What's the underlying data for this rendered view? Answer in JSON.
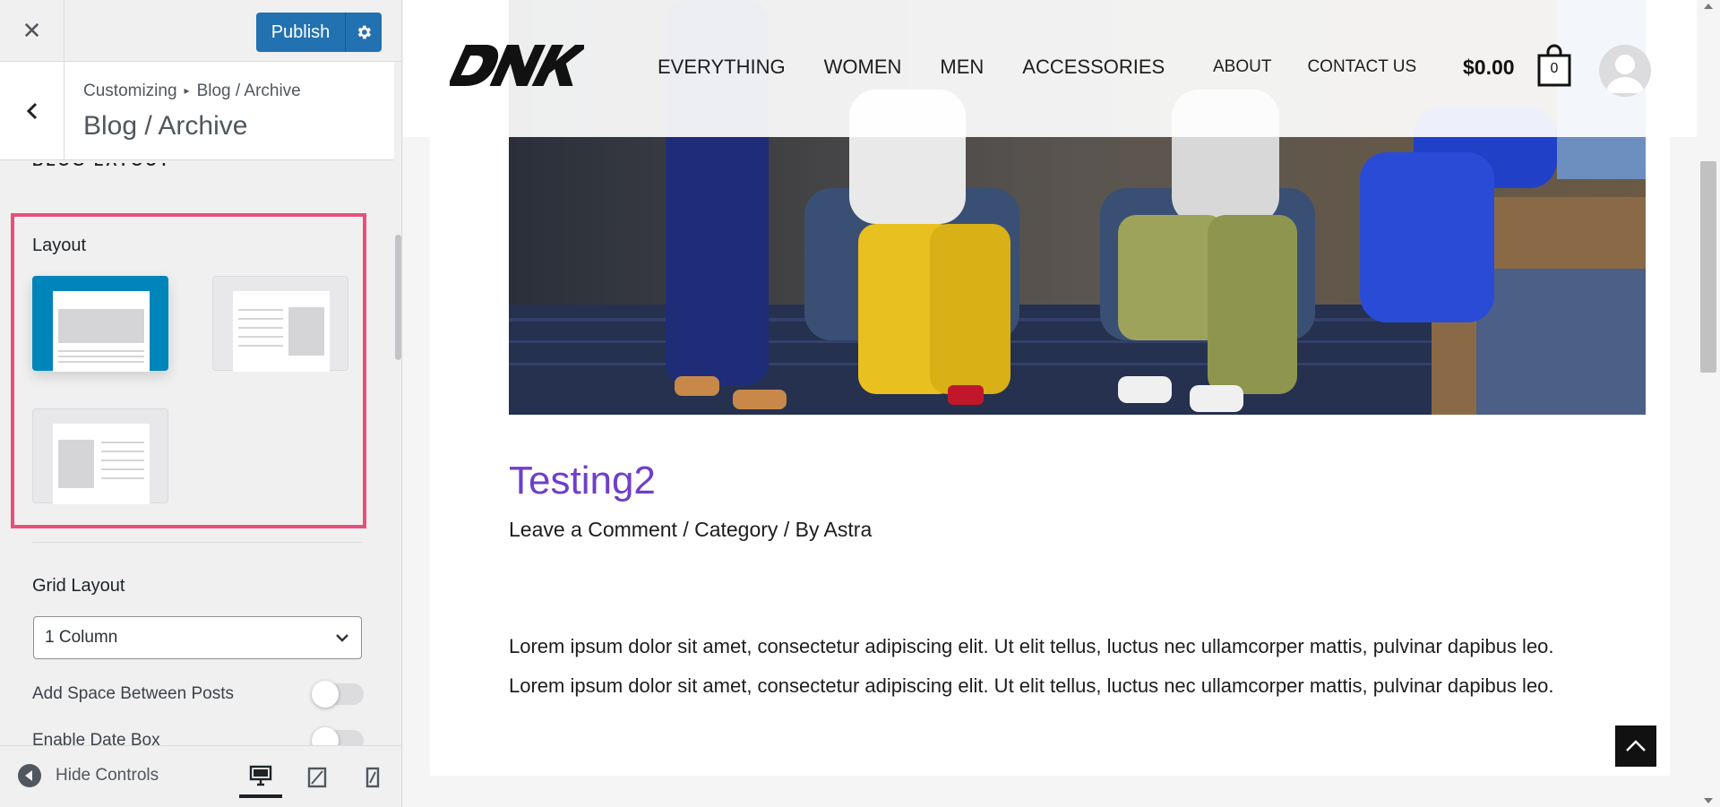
{
  "customizer": {
    "close_icon": "close-icon",
    "publish_label": "Publish",
    "publish_settings_icon": "gear-icon",
    "breadcrumb_root": "Customizing",
    "breadcrumb_separator": "▸",
    "breadcrumb_current": "Blog / Archive",
    "section_title": "Blog / Archive",
    "group_heading": "BLOG LAYOUT",
    "layout_label": "Layout",
    "layout_options": [
      {
        "name": "blog-layout-1",
        "selected": true
      },
      {
        "name": "blog-layout-2",
        "selected": false
      },
      {
        "name": "blog-layout-3",
        "selected": false
      }
    ],
    "grid_layout_label": "Grid Layout",
    "grid_layout_value": "1 Column",
    "toggles": [
      {
        "label": "Add Space Between Posts",
        "on": false
      },
      {
        "label": "Enable Date Box",
        "on": false
      }
    ],
    "hide_controls_label": "Hide Controls",
    "devices": [
      "desktop",
      "tablet",
      "mobile"
    ],
    "active_device": "desktop"
  },
  "site": {
    "logo_text": "DNK",
    "nav_primary": [
      "EVERYTHING",
      "WOMEN",
      "MEN",
      "ACCESSORIES"
    ],
    "nav_secondary": [
      "ABOUT",
      "CONTACT US"
    ],
    "cart_total": "$0.00",
    "cart_count": "0",
    "accent_color": "#6f3fc9"
  },
  "post": {
    "title": "Testing2",
    "meta": "Leave a Comment / Category / By Astra",
    "body_line_1": "Lorem ipsum dolor sit amet, consectetur adipiscing elit. Ut elit tellus, luctus nec ullamcorper mattis, pulvinar dapibus leo.",
    "body_line_2": "Lorem ipsum dolor sit amet, consectetur adipiscing elit. Ut elit tellus, luctus nec ullamcorper mattis, pulvinar dapibus leo."
  },
  "colors": {
    "highlight_border": "#e94f7b",
    "wp_blue": "#2271b1",
    "selected_layout": "#0085ba"
  }
}
